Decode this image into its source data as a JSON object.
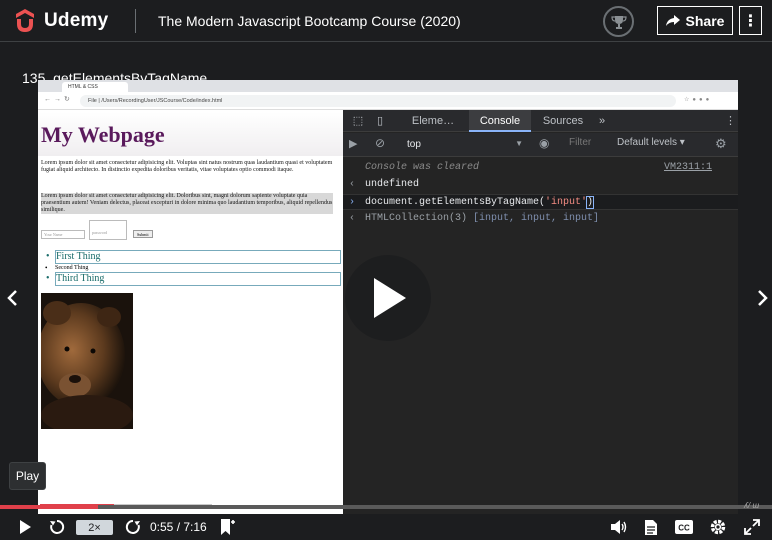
{
  "header": {
    "brand": "Udemy",
    "course_title": "The Modern Javascript Bootcamp Course (2020)",
    "share_label": "Share",
    "more_label": "⋮"
  },
  "lecture": {
    "title": "135. getElementsByTagName"
  },
  "browser": {
    "tab_title": "HTML & CSS",
    "url": "File  |  /Users/RecordingUser/JSCourse/Code/index.html"
  },
  "webpage": {
    "heading": "My Webpage",
    "paragraph1": "Lorem ipsum dolor sit amet consectetur adipisicing elit. Voluptas sint natus nostrum quas laudantium quasi et voluptatem fugiat aliquid architecto. In distinctio expedita doloribus veritatis, vitae voluptates optio commodi itaque.",
    "paragraph2": "Lorem ipsum dolor sit amet consectetur adipisicing elit. Doloribus sint, magni dolorum sapiente voluptate quia praesentium autem! Veniam delectus, placeat excepturi in dolore minima quo laudantium temporibus, aliquid repellendus similique.",
    "input1_placeholder": "Your Name",
    "input2_placeholder": "password",
    "submit_label": "Submit",
    "list": [
      "First Thing",
      "Second Thing",
      "Third Thing"
    ]
  },
  "devtools": {
    "tabs": [
      "Eleme…",
      "Console",
      "Sources",
      "»"
    ],
    "context": "top",
    "filter_placeholder": "Filter",
    "levels": "Default levels ▾",
    "console_cleared": "Console was cleared",
    "vm_link": "VM2311:1",
    "line_undefined": "undefined",
    "command_prefix": "document.getElementsByTagName(",
    "command_arg": "'input'",
    "command_suffix": ")",
    "result_head": "HTMLCollection(3) ",
    "result_items": "[input, input, input]"
  },
  "player": {
    "tooltip": "Play",
    "speed": "2×",
    "time": "0:55 / 7:16",
    "progress_fraction": 0.127,
    "watermark": "ʎ/ ɯ"
  },
  "colors": {
    "accent": "#e0404a",
    "background": "#1c1d1f",
    "brand": "#a435f0"
  }
}
